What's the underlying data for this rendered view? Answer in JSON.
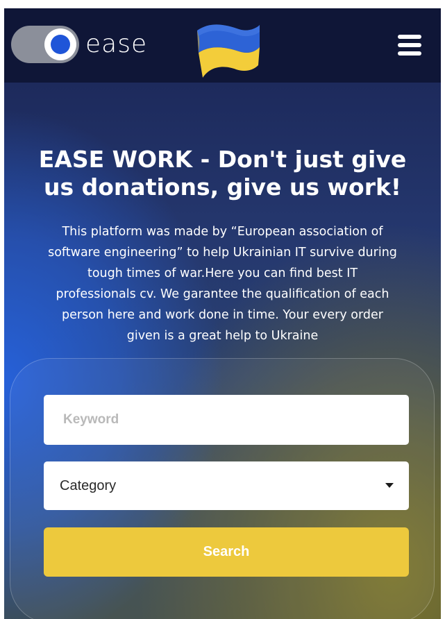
{
  "header": {
    "logo_text": "ease",
    "menu_icon": "hamburger-menu-icon",
    "flag_icon": "ukraine-flag-icon",
    "background": "#0f1637"
  },
  "hero": {
    "title_line1": "EASE WORK - Don't just give",
    "title_line2": "us donations, give us work!",
    "description_lines": [
      "This platform was made by “European association of",
      "software engineering” to help Ukrainian IT survive during",
      "tough times of war.Here you can find best IT",
      "professionals cv. We garantee the qualification of each",
      "person here and work done in time. Your every order",
      "given is a great help to Ukraine"
    ]
  },
  "search_form": {
    "keyword_placeholder": "Keyword",
    "keyword_value": "",
    "category_selected": "Category",
    "search_label": "Search"
  },
  "colors": {
    "accent_yellow": "#edc93d",
    "flag_blue": "#2d63d6",
    "flag_yellow": "#f3cd3a",
    "logo_blue": "#1f55d8"
  }
}
